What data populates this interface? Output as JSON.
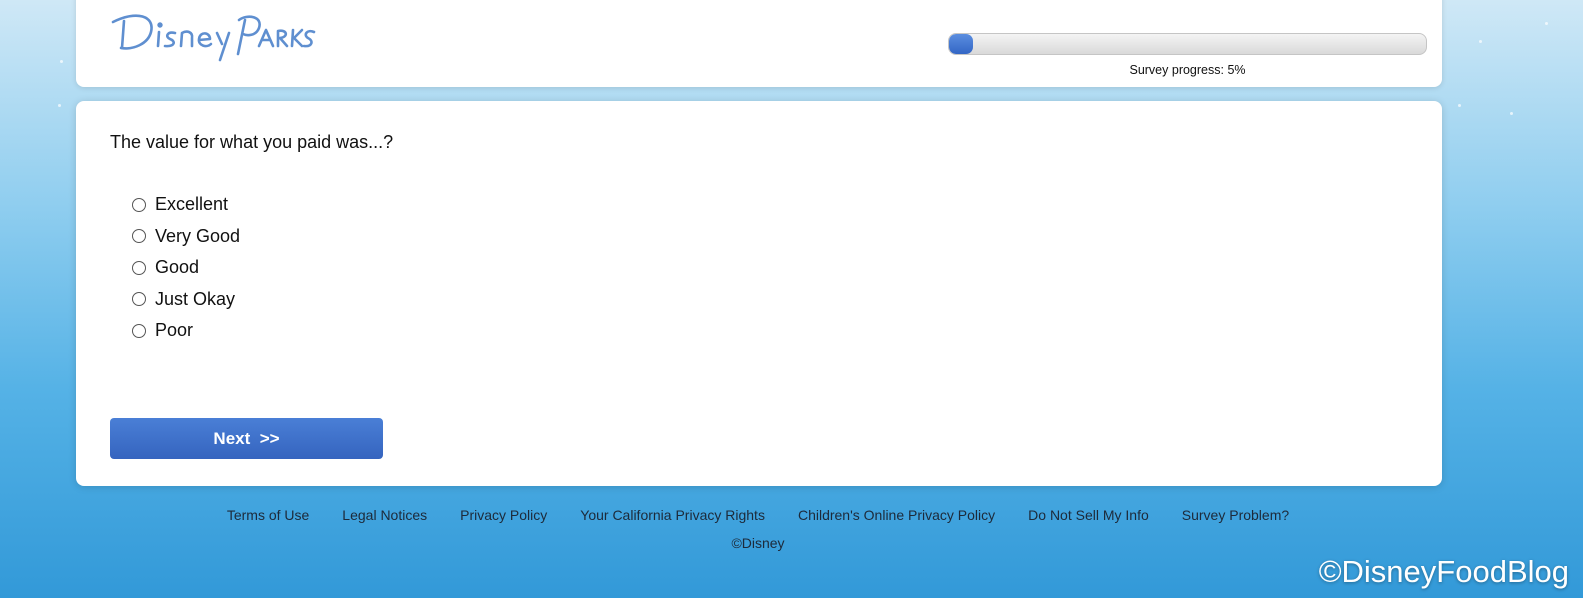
{
  "header": {
    "logo_text": "Disney Parks",
    "progress": {
      "label": "Survey progress: 5%",
      "fraction": 0.05
    }
  },
  "survey": {
    "question": "The value for what you paid was...?",
    "options": [
      "Excellent",
      "Very Good",
      "Good",
      "Just Okay",
      "Poor"
    ],
    "next_label": "Next  >>"
  },
  "footer": {
    "links": [
      "Terms of Use",
      "Legal Notices",
      "Privacy Policy",
      "Your California Privacy Rights",
      "Children's Online Privacy Policy",
      "Do Not Sell My Info",
      "Survey Problem?"
    ],
    "copyright": "©Disney"
  },
  "watermark": "©DisneyFoodBlog",
  "colors": {
    "accent": "#3a6fcf",
    "logo": "#5f8fd0",
    "background": "#55b2e6"
  }
}
